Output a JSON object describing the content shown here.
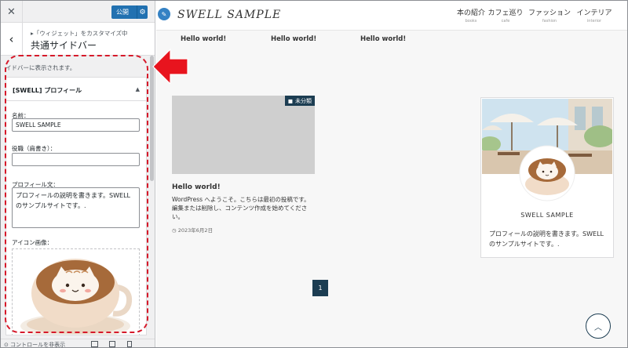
{
  "customizer": {
    "close_icon": "close-icon",
    "publish_label": "公開",
    "gear_icon": "gear-icon",
    "back_icon": "chevron-left-icon",
    "breadcrumb": "▸「ウィジェット」をカスタマイズ中",
    "heading": "共通サイドバー",
    "description": "イドバーに表示されます。",
    "widget": {
      "title": "[SWELL] プロフィール",
      "toggle_icon": "triangle-up-icon",
      "name_label": "名前：",
      "name_value": "SWELL SAMPLE",
      "role_label": "役職（肩書き）：",
      "role_value": "",
      "bio_label": "プロフィール文：",
      "bio_value": "プロフィールの説明を書きます。SWELL のサンプルサイトです。.",
      "icon_label": "アイコン画像："
    },
    "footer": {
      "hide_controls": "コントロールを非表示"
    }
  },
  "site": {
    "logo": "SWELL SAMPLE",
    "nav": [
      {
        "jp": "本の紹介",
        "en": "books"
      },
      {
        "jp": "カフェ巡り",
        "en": "cafe"
      },
      {
        "jp": "ファッション",
        "en": "fashion"
      },
      {
        "jp": "インテリア",
        "en": "interior"
      }
    ],
    "featured": [
      "Hello world!",
      "Hello world!",
      "Hello world!"
    ],
    "post": {
      "category": "未分類",
      "title": "Hello world!",
      "excerpt": "WordPress へようこそ。こちらは最初の投稿です。編集または削除し、コンテンツ作成を始めてください。",
      "date": "2023年6月2日"
    },
    "profile": {
      "name": "SWELL SAMPLE",
      "desc": "プロフィールの説明を書きます。SWELL のサンプルサイトです。."
    },
    "pagination": "1",
    "page_top_icon": "chevron-up-icon"
  },
  "colors": {
    "accent": "#2271b1",
    "site_dark": "#1c3d52",
    "highlight_red": "#d6192a"
  }
}
